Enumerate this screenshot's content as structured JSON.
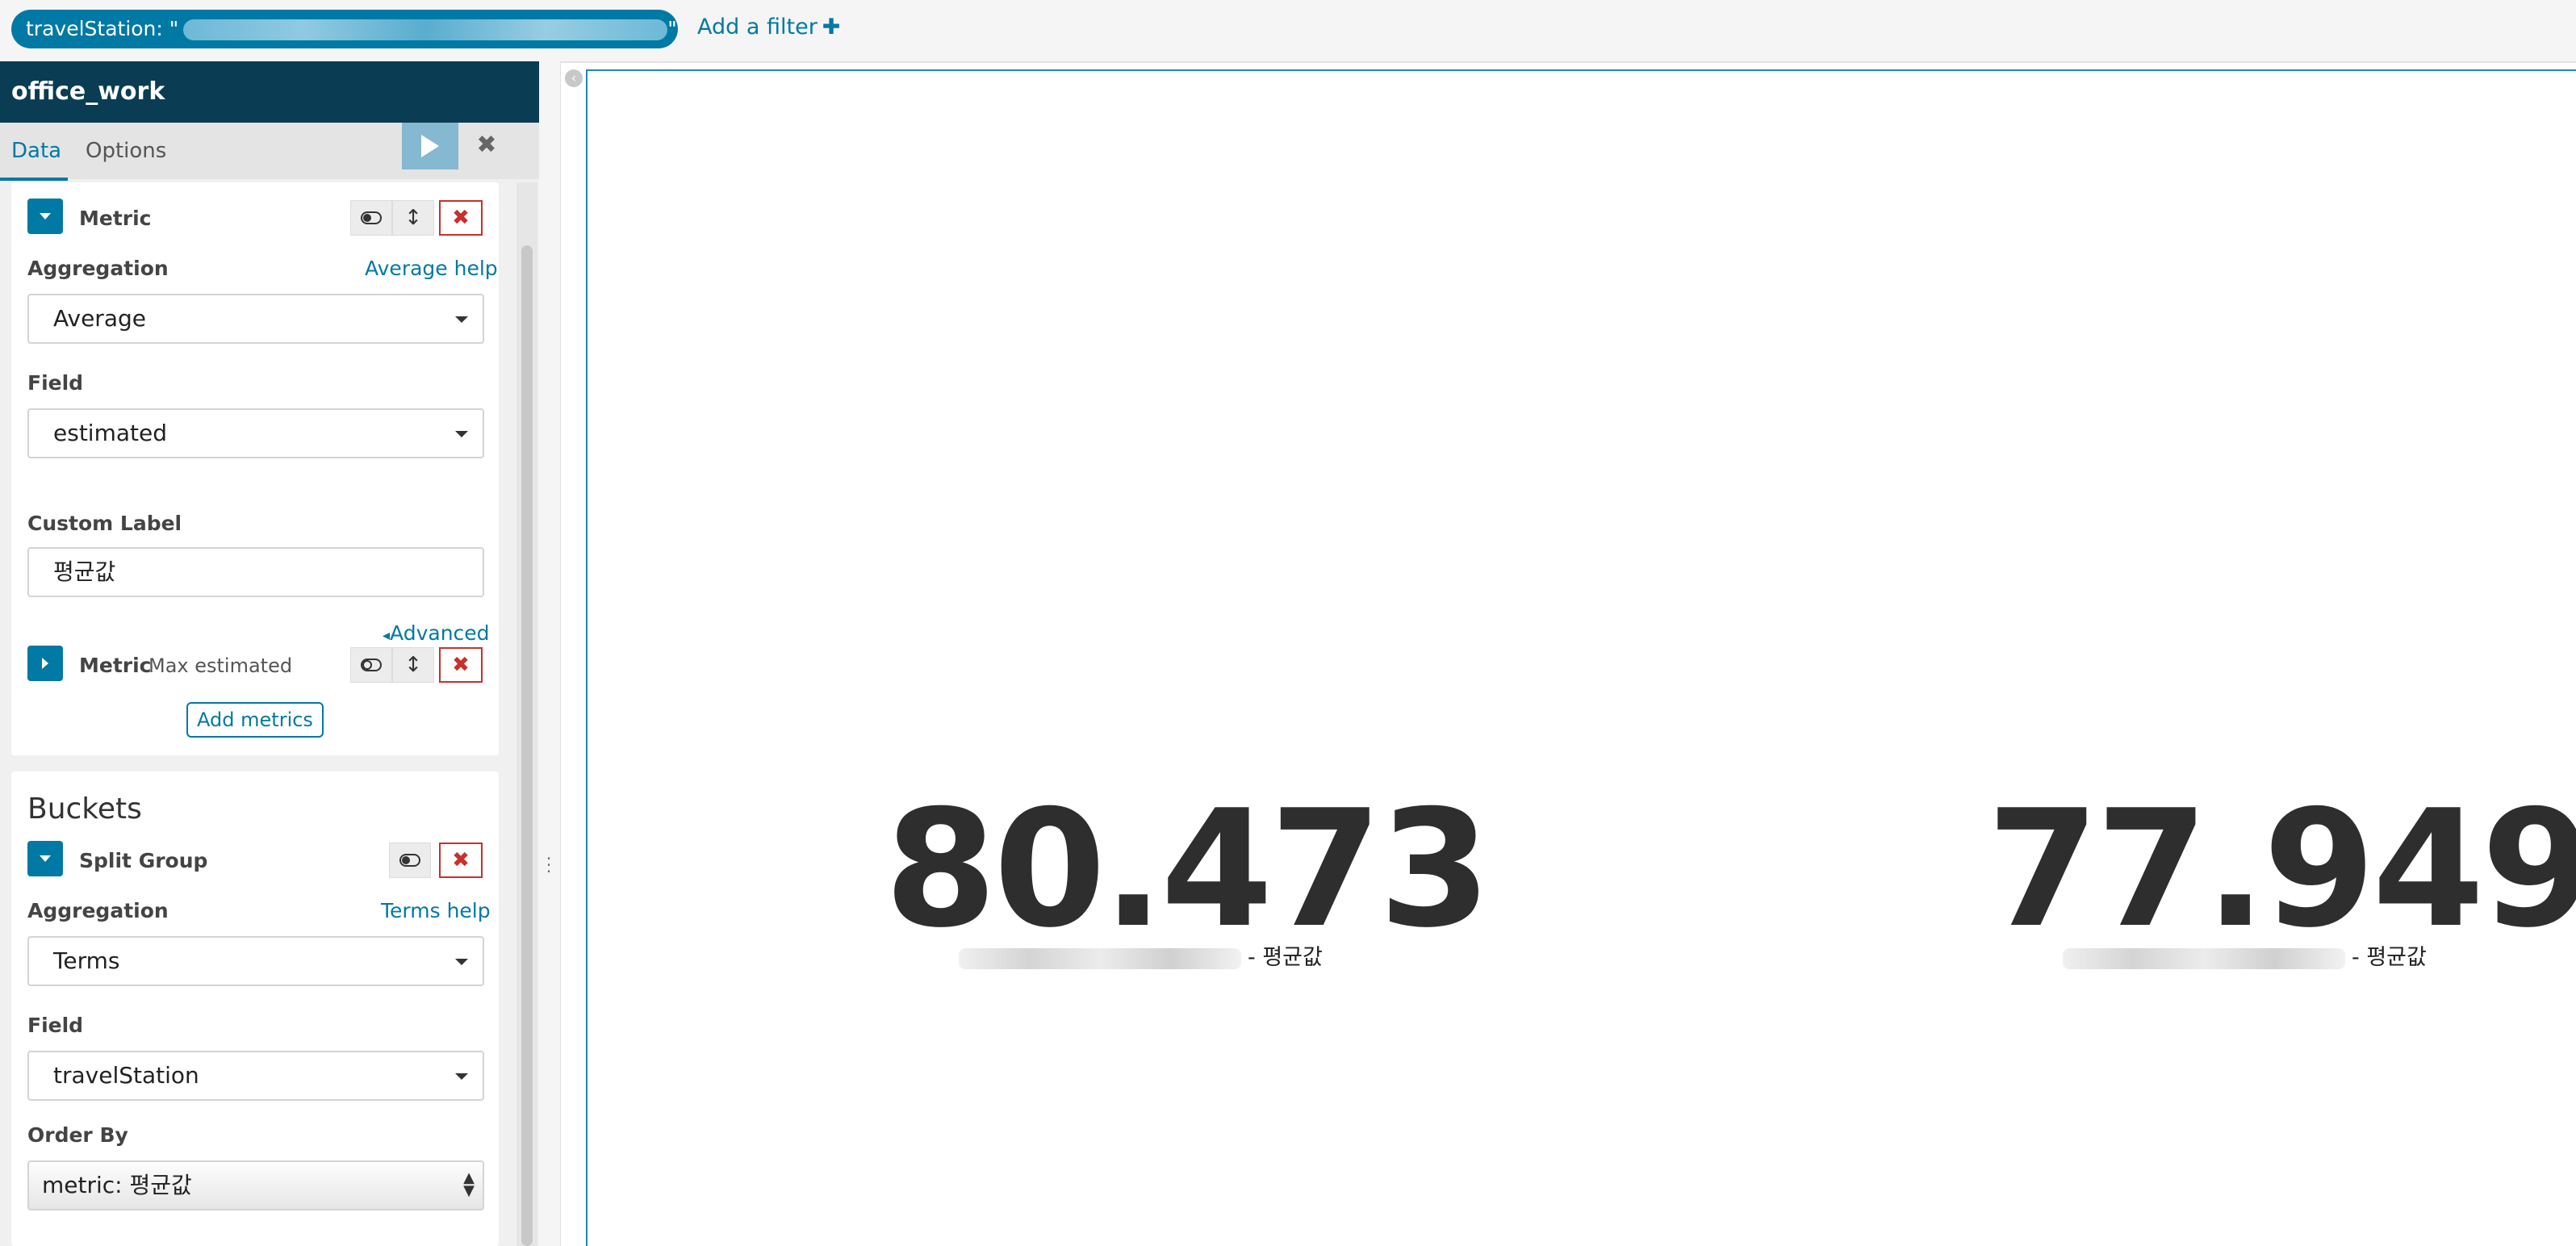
{
  "filter_bar": {
    "filter_pill_label": "travelStation: \"",
    "add_filter_label": "Add a filter",
    "add_filter_icon": "plus-icon"
  },
  "sidebar": {
    "title": "office_work",
    "tabs": [
      {
        "label": "Data",
        "active": true
      },
      {
        "label": "Options",
        "active": false
      }
    ],
    "metrics": [
      {
        "label": "Metric",
        "expanded": true,
        "aggregation_label": "Aggregation",
        "aggregation_help": "Average help",
        "aggregation_value": "Average",
        "field_label": "Field",
        "field_value": "estimated",
        "custom_label_label": "Custom Label",
        "custom_label_value": "평균값",
        "advanced_label": "Advanced"
      },
      {
        "label": "Metric",
        "expanded": false,
        "subtitle": "Max estimated"
      }
    ],
    "add_metrics_label": "Add metrics",
    "buckets": {
      "heading": "Buckets",
      "split_label": "Split Group",
      "aggregation_label": "Aggregation",
      "aggregation_help": "Terms help",
      "aggregation_value": "Terms",
      "field_label": "Field",
      "field_value": "travelStation",
      "order_by_label": "Order By",
      "order_by_value": "metric: 평균값"
    }
  },
  "visualization": {
    "metrics": [
      {
        "value": "80.473",
        "label_suffix": "- 평균값"
      },
      {
        "value": "77.949",
        "label_suffix": "- 평균값"
      }
    ]
  },
  "colors": {
    "accent": "#0079a5",
    "title_bar": "#0a3d54",
    "danger": "#c9302c"
  }
}
